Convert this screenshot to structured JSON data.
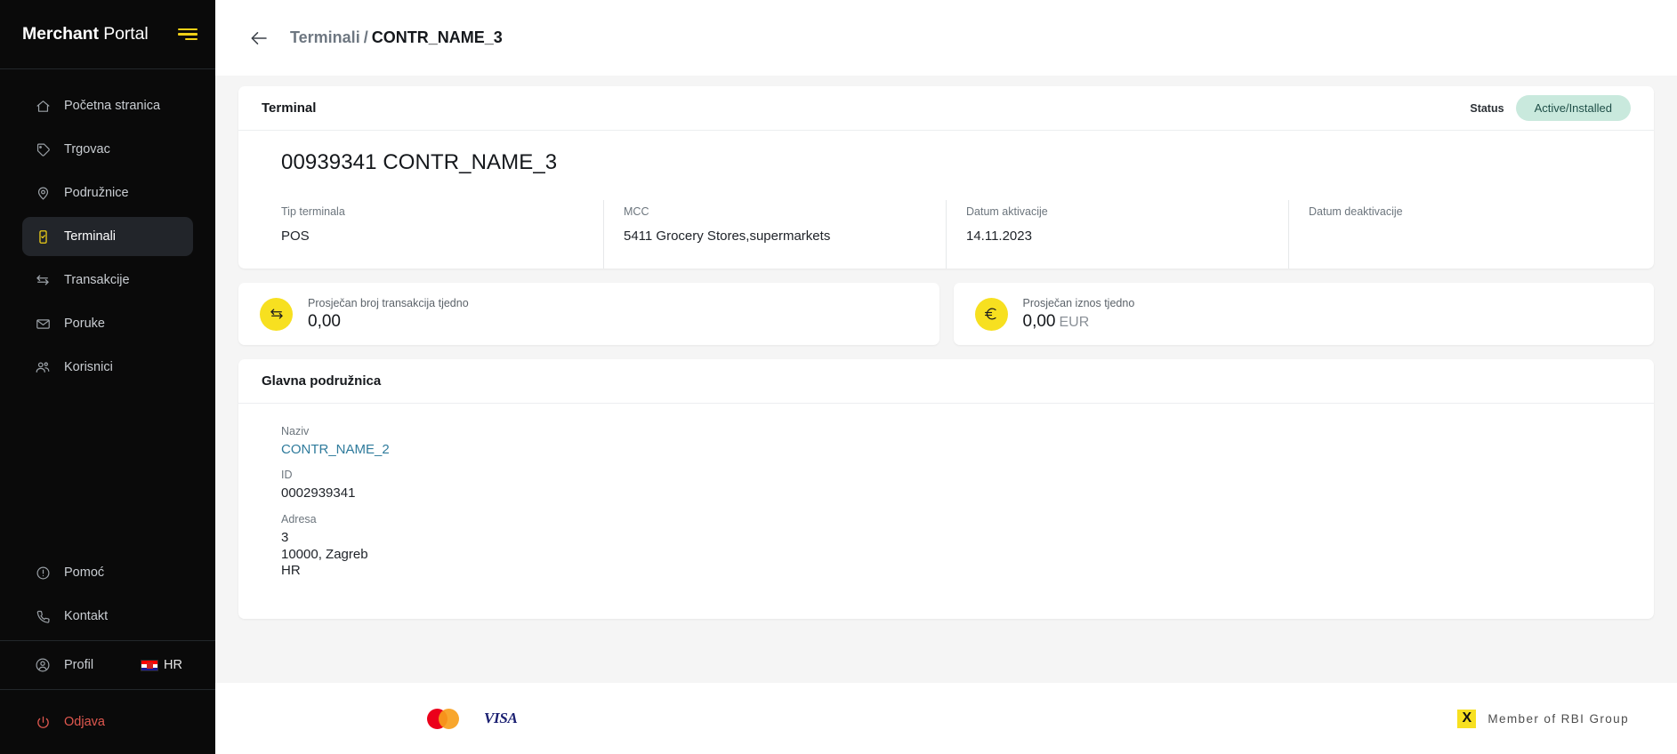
{
  "sidebar": {
    "brand": {
      "strong": "Merchant",
      "light": " Portal"
    },
    "menu_icon": "hamburger-icon",
    "items": [
      {
        "label": "Početna stranica",
        "icon": "home-icon",
        "active": false
      },
      {
        "label": "Trgovac",
        "icon": "tag-icon",
        "active": false
      },
      {
        "label": "Podružnice",
        "icon": "location-pin-icon",
        "active": false
      },
      {
        "label": "Terminali",
        "icon": "terminal-device-icon",
        "active": true
      },
      {
        "label": "Transakcije",
        "icon": "exchange-arrows-icon",
        "active": false
      },
      {
        "label": "Poruke",
        "icon": "envelope-icon",
        "active": false
      },
      {
        "label": "Korisnici",
        "icon": "users-icon",
        "active": false
      }
    ],
    "help": {
      "label": "Pomoć",
      "icon": "info-circle-icon"
    },
    "contact": {
      "label": "Kontakt",
      "icon": "phone-icon"
    },
    "profile": {
      "label": "Profil",
      "icon": "user-circle-icon"
    },
    "language": {
      "code": "HR",
      "flag": "croatia-flag-icon"
    },
    "logout": {
      "label": "Odjava",
      "icon": "power-icon"
    }
  },
  "topbar": {
    "back_icon": "arrow-left-icon",
    "breadcrumb_parent": "Terminali",
    "breadcrumb_separator": "/",
    "breadcrumb_current": "CONTR_NAME_3"
  },
  "terminal_card": {
    "title": "Terminal",
    "status_label": "Status",
    "status_value": "Active/Installed",
    "status_bg": "#c9e9dd",
    "status_fg": "#1f4f48",
    "name": "00939341 CONTR_NAME_3",
    "fields": [
      {
        "label": "Tip terminala",
        "value": "POS"
      },
      {
        "label": "MCC",
        "value": "5411  Grocery Stores,supermarkets"
      },
      {
        "label": "Datum aktivacije",
        "value": "14.11.2023"
      },
      {
        "label": "Datum deaktivacije",
        "value": ""
      }
    ]
  },
  "stats": [
    {
      "icon": "exchange-arrows-icon",
      "label": "Prosječan broj transakcija tjedno",
      "value": "0,00",
      "currency": ""
    },
    {
      "icon": "euro-icon",
      "label": "Prosječan iznos tjedno",
      "value": "0,00",
      "currency": "EUR"
    }
  ],
  "branch_card": {
    "title": "Glavna podružnica",
    "name_label": "Naziv",
    "name_value": "CONTR_NAME_2",
    "id_label": "ID",
    "id_value": "0002939341",
    "address_label": "Adresa",
    "address_line1": "3",
    "address_line2": "10000, Zagreb",
    "address_line3": "HR"
  },
  "footer": {
    "mastercard": "mastercard-logo",
    "visa": "VISA",
    "rbi_mark": "X",
    "rbi_text": "Member of RBI Group"
  },
  "colors": {
    "accent_yellow": "#f7e020",
    "sidebar_bg": "#0a0a0a",
    "logout_red": "#e0584f",
    "link_blue": "#2f7b9c"
  }
}
